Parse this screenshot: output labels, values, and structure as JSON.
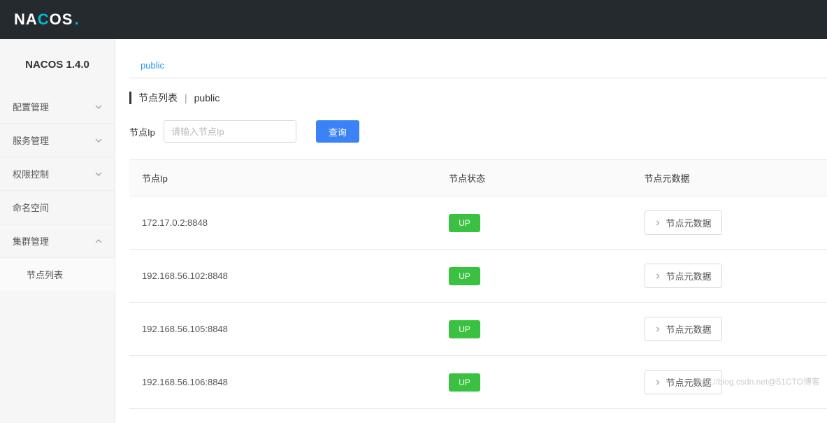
{
  "logo": {
    "part1": "NA",
    "part2": "C",
    "part3": "OS",
    "dot": "."
  },
  "sidebar": {
    "version": "NACOS 1.4.0",
    "items": [
      {
        "label": "配置管理",
        "expandable": true,
        "expanded": false
      },
      {
        "label": "服务管理",
        "expandable": true,
        "expanded": false
      },
      {
        "label": "权限控制",
        "expandable": true,
        "expanded": false
      },
      {
        "label": "命名空间",
        "expandable": false
      },
      {
        "label": "集群管理",
        "expandable": true,
        "expanded": true,
        "children": [
          {
            "label": "节点列表"
          }
        ]
      }
    ]
  },
  "main": {
    "tabs": [
      {
        "label": "public",
        "active": true
      }
    ],
    "title": {
      "main": "节点列表",
      "sub": "public"
    },
    "search": {
      "label": "节点Ip",
      "placeholder": "请输入节点Ip",
      "value": "",
      "button": "查询"
    },
    "table": {
      "headers": {
        "ip": "节点Ip",
        "status": "节点状态",
        "meta": "节点元数据"
      },
      "meta_button": "节点元数据",
      "rows": [
        {
          "ip": "172.17.0.2:8848",
          "status": "UP"
        },
        {
          "ip": "192.168.56.102:8848",
          "status": "UP"
        },
        {
          "ip": "192.168.56.105:8848",
          "status": "UP"
        },
        {
          "ip": "192.168.56.106:8848",
          "status": "UP"
        }
      ]
    }
  },
  "watermark": "https://blog.csdn.net@51CTO博客"
}
